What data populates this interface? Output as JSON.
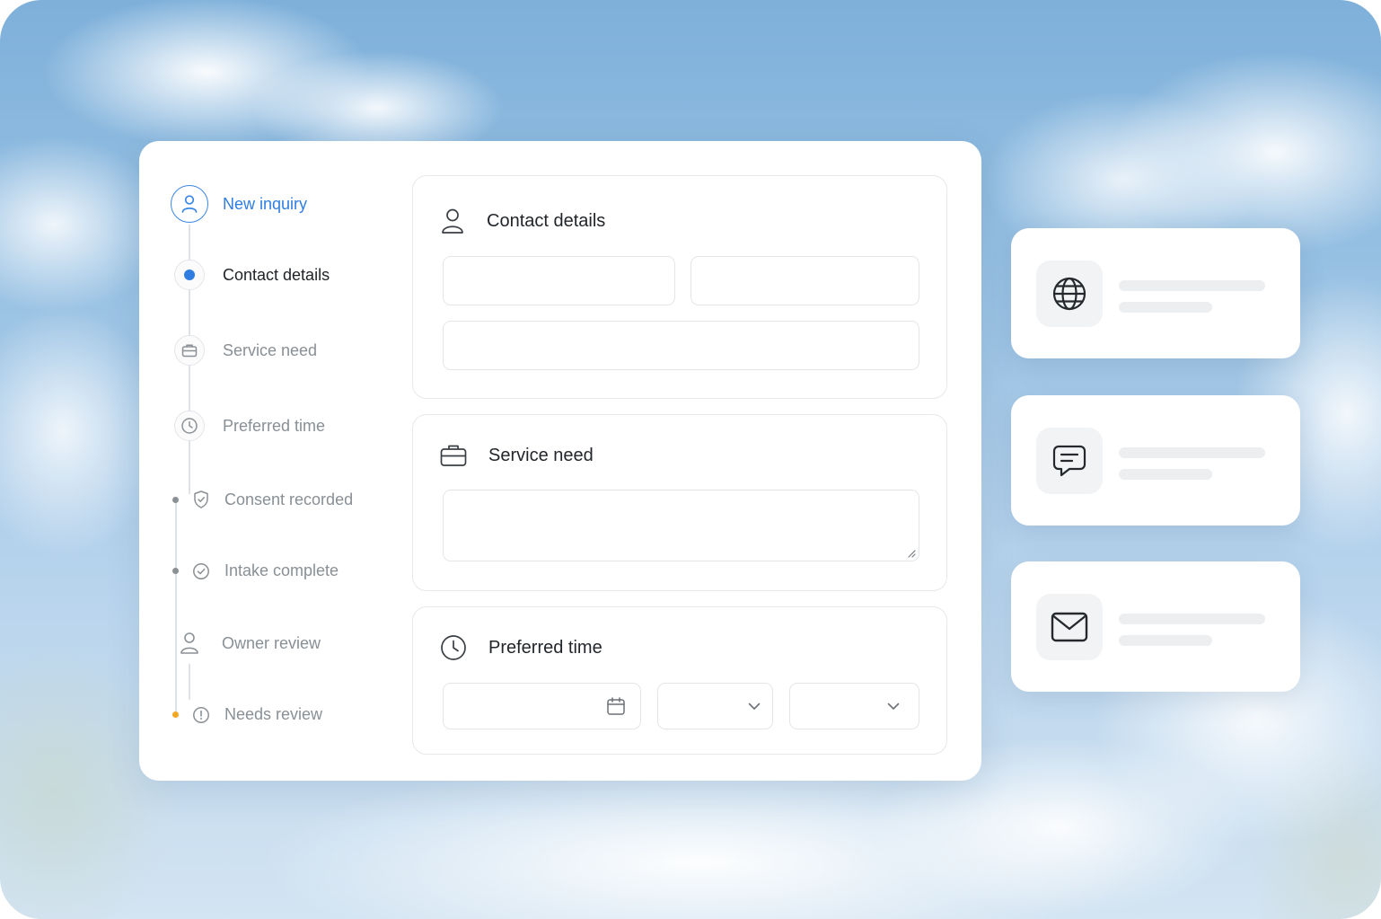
{
  "stepper": {
    "steps": [
      {
        "label": "New inquiry",
        "icon": "person-icon",
        "state": "done"
      },
      {
        "label": "Contact details",
        "icon": "dot-icon",
        "state": "current"
      },
      {
        "label": "Service need",
        "icon": "briefcase-icon",
        "state": "pending"
      },
      {
        "label": "Preferred time",
        "icon": "clock-icon",
        "state": "pending"
      },
      {
        "label": "Consent recorded",
        "icon": "shield-check-icon",
        "state": "pending"
      },
      {
        "label": "Intake complete",
        "icon": "check-circle-icon",
        "state": "pending"
      },
      {
        "label": "Owner review",
        "icon": "person-icon",
        "state": "pending"
      },
      {
        "label": "Needs review",
        "icon": "alert-circle-icon",
        "state": "warning"
      }
    ]
  },
  "sections": {
    "contact": {
      "title": "Contact details",
      "icon": "person-icon"
    },
    "service": {
      "title": "Service need",
      "icon": "briefcase-icon"
    },
    "time": {
      "title": "Preferred time",
      "icon": "clock-icon"
    }
  },
  "side_cards": [
    {
      "icon": "globe-icon"
    },
    {
      "icon": "chat-icon"
    },
    {
      "icon": "mail-icon"
    }
  ],
  "colors": {
    "accent": "#2f7de1",
    "warning": "#f0a824",
    "muted_text": "#888f95",
    "text": "#22262a"
  }
}
